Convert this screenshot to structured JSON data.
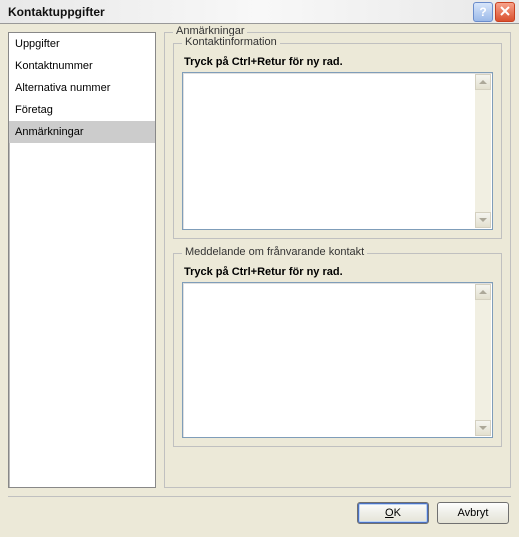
{
  "title": "Kontaktuppgifter",
  "sidebar": {
    "items": [
      {
        "label": "Uppgifter"
      },
      {
        "label": "Kontaktnummer"
      },
      {
        "label": "Alternativa nummer"
      },
      {
        "label": "Företag"
      },
      {
        "label": "Anmärkningar"
      }
    ],
    "selected_index": 4
  },
  "main": {
    "group_label": "Anmärkningar",
    "contact_info": {
      "legend": "Kontaktinformation",
      "hint": "Tryck på Ctrl+Retur för ny rad.",
      "value": ""
    },
    "absent_contact": {
      "legend": "Meddelande om frånvarande kontakt",
      "hint": "Tryck på Ctrl+Retur för ny rad.",
      "value": ""
    }
  },
  "footer": {
    "ok_label": "OK",
    "cancel_label": "Avbryt"
  },
  "icons": {
    "help": "?",
    "close": "×"
  }
}
